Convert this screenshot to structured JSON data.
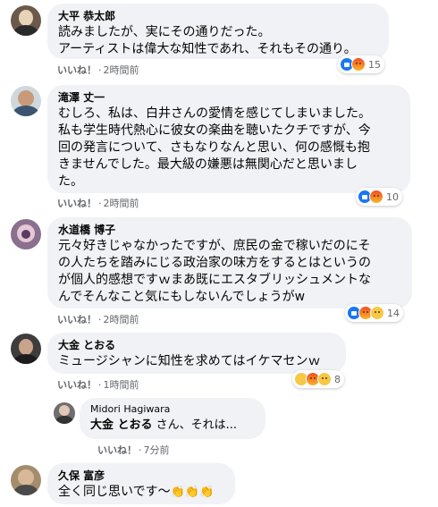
{
  "like_label": "いいね！",
  "comments": [
    {
      "author": "大平 恭太郎",
      "text": "読みましたが、実にその通りだった。\nアーティストは偉大な知性であれ、それもその通り。",
      "time": "2時間前",
      "reactions": [
        "like",
        "angry"
      ],
      "reaction_count": "15"
    },
    {
      "author": "滝澤 丈一",
      "text": "むしろ、私は、白井さんの愛情を感じてしまいました。\n私も学生時代熱心に彼女の楽曲を聴いたクチですが、今\n回の発言について、さもなりなんと思い、何の感慨も抱\nきませんでした。最大級の嫌悪は無関心だと思いまし\nた。",
      "time": "2時間前",
      "reactions": [
        "like",
        "angry"
      ],
      "reaction_count": "10"
    },
    {
      "author": "水道橋 博子",
      "text": "元々好きじゃなかったですが、庶民の金で稼いだのにそ\nの人たちを踏みにじる政治家の味方をするとはというの\nが個人的感想ですｗまあ既にエスタブリッシュメントな\nんでそんなこと気にもしないんでしょうがw",
      "time": "2時間前",
      "reactions": [
        "like",
        "angry",
        "sad"
      ],
      "reaction_count": "14"
    },
    {
      "author": "大金 とおる",
      "text": "ミュージシャンに知性を求めてはイケマセンｗ",
      "time": "1時間前",
      "reactions": [
        "haha",
        "angry",
        "wow"
      ],
      "reaction_count": "8"
    }
  ],
  "reply": {
    "author": "Midori Hagiwara",
    "mention": "大金 とおる",
    "text": " さん、それは...",
    "time": "7分前"
  },
  "last_comment": {
    "author": "久保 富彦",
    "text": "全く同じ思いです〜",
    "clap_icons": "👏👏👏"
  },
  "colors": {
    "bubble": "#f0f2f5",
    "meta": "#65676b",
    "like_blue": "#1877f2"
  }
}
